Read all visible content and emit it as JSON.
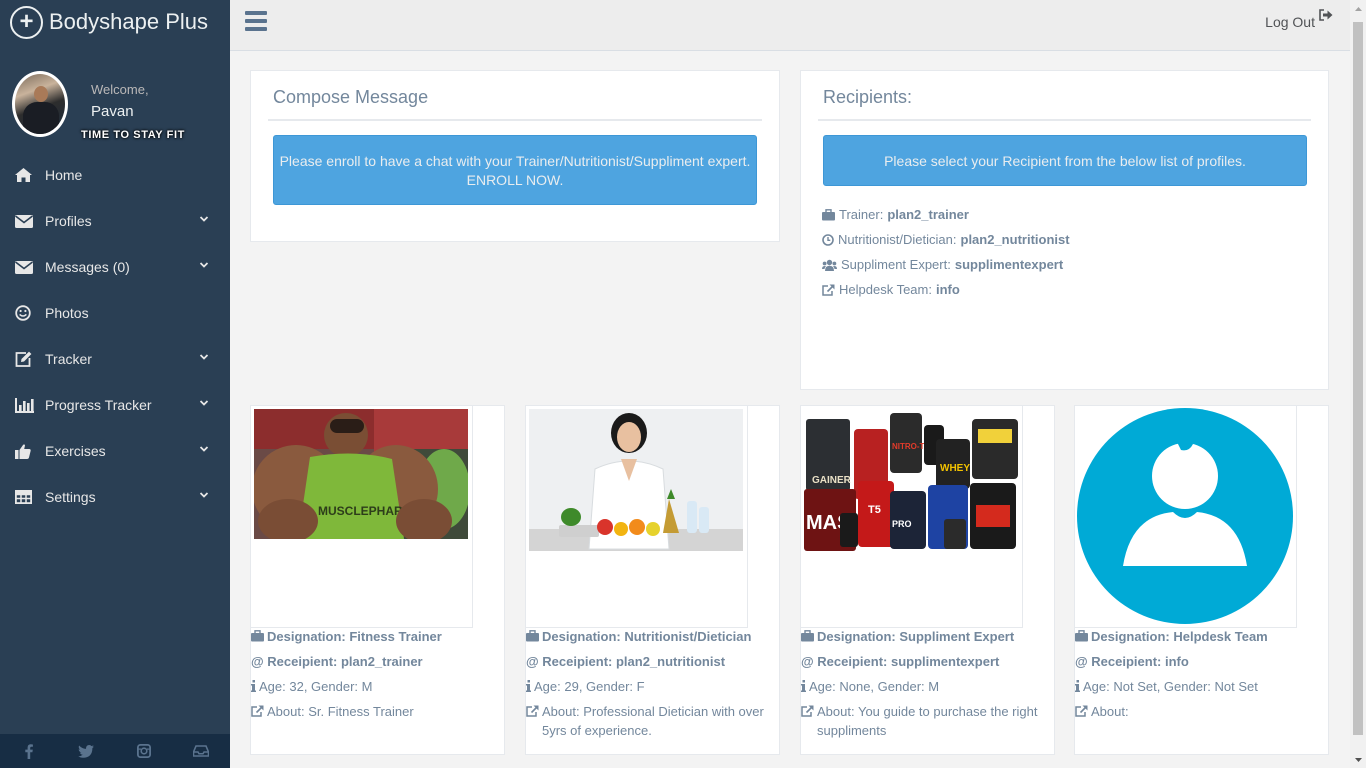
{
  "brand": {
    "name": "Bodyshape Plus"
  },
  "profile": {
    "welcome": "Welcome,",
    "name": "Pavan",
    "motto": "TIME TO STAY FIT"
  },
  "menu": [
    {
      "label": "Home",
      "icon": "home-icon",
      "expandable": false
    },
    {
      "label": "Profiles",
      "icon": "envelope-icon",
      "expandable": true
    },
    {
      "label": "Messages (0)",
      "icon": "envelope-icon",
      "expandable": true
    },
    {
      "label": "Photos",
      "icon": "smile-icon",
      "expandable": false
    },
    {
      "label": "Tracker",
      "icon": "edit-icon",
      "expandable": true
    },
    {
      "label": "Progress Tracker",
      "icon": "bar-chart-icon",
      "expandable": true
    },
    {
      "label": "Exercises",
      "icon": "thumbs-up-icon",
      "expandable": true
    },
    {
      "label": "Settings",
      "icon": "table-icon",
      "expandable": true
    }
  ],
  "footer_icons": [
    "facebook-icon",
    "twitter-icon",
    "instagram-icon",
    "inbox-icon"
  ],
  "topnav": {
    "logout_label": "Log Out"
  },
  "compose": {
    "title": "Compose Message",
    "alert_line1": "Please enroll to have a chat with your Trainer/Nutritionist/Suppliment expert.",
    "alert_line2": "ENROLL NOW."
  },
  "recipients": {
    "title": "Recipients:",
    "alert": "Please select your Recipient from the below list of profiles.",
    "list": [
      {
        "icon": "briefcase-icon",
        "role": "Trainer:",
        "name": "plan2_trainer"
      },
      {
        "icon": "clock-icon",
        "role": "Nutritionist/Dietician:",
        "name": "plan2_nutritionist"
      },
      {
        "icon": "users-icon",
        "role": "Suppliment Expert:",
        "name": "supplimentexpert"
      },
      {
        "icon": "external-link-icon",
        "role": "Helpdesk Team:",
        "name": "info"
      }
    ]
  },
  "cards": [
    {
      "designation": "Designation: Fitness Trainer",
      "recipient": "@ Receipient: plan2_trainer",
      "details": "Age: 32, Gender: M",
      "about": "About: Sr. Fitness Trainer",
      "image": "trainer-photo"
    },
    {
      "designation": "Designation: Nutritionist/Dietician",
      "recipient": "@ Receipient: plan2_nutritionist",
      "details": "Age: 29, Gender: F",
      "about": "About: Professional Dietician with over 5yrs of experience.",
      "image": "nutritionist-photo"
    },
    {
      "designation": "Designation: Suppliment Expert",
      "recipient": "@ Receipient: supplimentexpert",
      "details": "Age: None, Gender: M",
      "about": "About: You guide to purchase the right suppliments",
      "image": "supplements-photo"
    },
    {
      "designation": "Designation: Helpdesk Team",
      "recipient": "@ Receipient: info",
      "details": "Age: Not Set, Gender: Not Set",
      "about": "About:",
      "image": "default-avatar"
    }
  ],
  "colors": {
    "sidebar": "#2a3f54",
    "alert_blue": "#4ea4e0",
    "text": "#73879c",
    "avatar_cyan": "#00aad6"
  }
}
